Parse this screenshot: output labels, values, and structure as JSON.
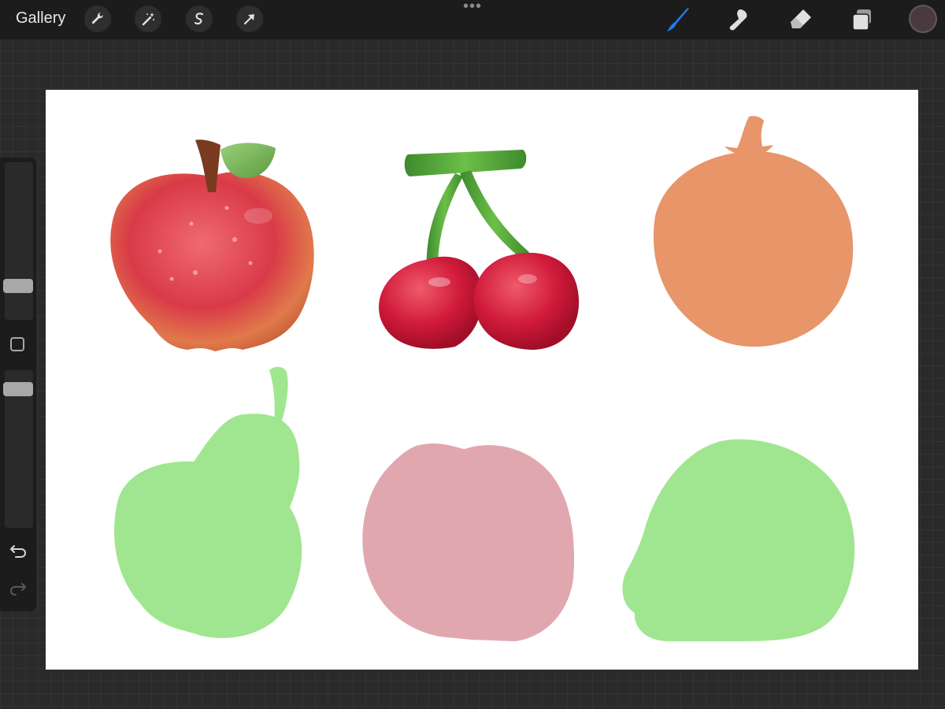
{
  "topbar": {
    "gallery_label": "Gallery",
    "left_tools": [
      "wrench-icon",
      "magic-wand-icon",
      "selection-icon",
      "transform-arrow-icon"
    ],
    "right_tools": [
      "brush-icon",
      "smudge-icon",
      "eraser-icon",
      "layers-icon"
    ],
    "active_tool": "brush",
    "current_color": "#4a3a40",
    "accent": "#1e7cf0"
  },
  "sidebar": {
    "tools": [
      "brush-size-slider",
      "modify-button",
      "opacity-slider",
      "undo-icon",
      "redo-icon"
    ]
  },
  "canvas": {
    "items": [
      {
        "name": "apple",
        "style": "painted",
        "color": "#d8404a"
      },
      {
        "name": "cherries",
        "style": "painted",
        "color": "#c81e3c"
      },
      {
        "name": "orange",
        "style": "flat",
        "color": "#e8956a"
      },
      {
        "name": "pear",
        "style": "flat",
        "color": "#a0e690"
      },
      {
        "name": "peach",
        "style": "flat",
        "color": "#e0a8ae"
      },
      {
        "name": "pear-2",
        "style": "flat",
        "color": "#a0e690"
      }
    ]
  }
}
